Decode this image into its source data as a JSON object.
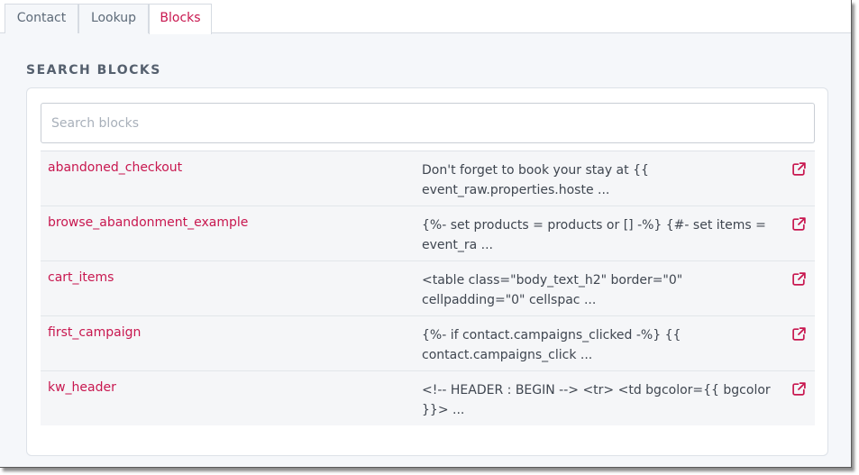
{
  "tabs": [
    {
      "label": "Contact",
      "active": false
    },
    {
      "label": "Lookup",
      "active": false
    },
    {
      "label": "Blocks",
      "active": true
    }
  ],
  "section_title": "SEARCH BLOCKS",
  "search": {
    "placeholder": "Search blocks",
    "value": ""
  },
  "blocks": [
    {
      "name": "abandoned_checkout",
      "preview": "Don't forget to book your stay at {{ event_raw.properties.hoste ...",
      "icon": "external-link-icon"
    },
    {
      "name": "browse_abandonment_example",
      "preview": "{%- set products = products or [] -%} {#- set items = event_ra ...",
      "icon": "external-link-icon"
    },
    {
      "name": "cart_items",
      "preview": "<table class=\"body_text_h2\" border=\"0\" cellpadding=\"0\" cellspac ...",
      "icon": "external-link-icon"
    },
    {
      "name": "first_campaign",
      "preview": "{%- if contact.campaigns_clicked -%} {{ contact.campaigns_click ...",
      "icon": "external-link-icon"
    },
    {
      "name": "kw_header",
      "preview": "<!-- HEADER : BEGIN --> <tr> <td bgcolor={{ bgcolor }}> ...",
      "icon": "external-link-icon"
    }
  ],
  "colors": {
    "accent": "#c8174f",
    "row_bg": "#f5f6f8",
    "page_bg": "#f5f7fa"
  }
}
